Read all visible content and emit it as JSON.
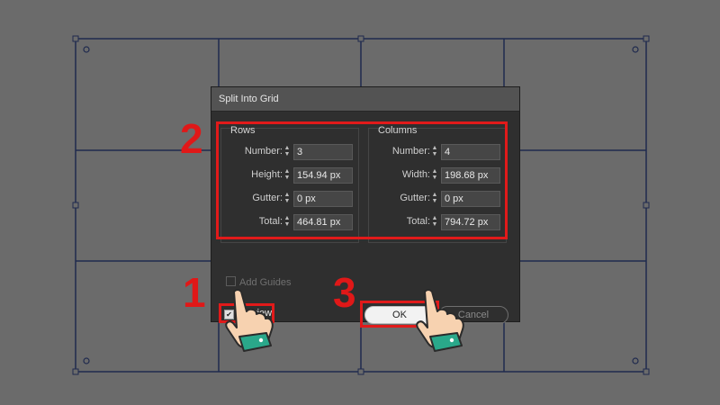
{
  "dialog": {
    "title": "Split Into Grid",
    "rows": {
      "title": "Rows",
      "fields": [
        {
          "label": "Number:",
          "value": "3"
        },
        {
          "label": "Height:",
          "value": "154.94 px"
        },
        {
          "label": "Gutter:",
          "value": "0 px"
        },
        {
          "label": "Total:",
          "value": "464.81 px"
        }
      ]
    },
    "columns": {
      "title": "Columns",
      "fields": [
        {
          "label": "Number:",
          "value": "4"
        },
        {
          "label": "Width:",
          "value": "198.68 px"
        },
        {
          "label": "Gutter:",
          "value": "0 px"
        },
        {
          "label": "Total:",
          "value": "794.72 px"
        }
      ]
    },
    "add_guides": {
      "label": "Add Guides",
      "checked": false
    },
    "preview": {
      "label": "Preview",
      "checked": true
    },
    "ok_label": "OK",
    "cancel_label": "Cancel"
  },
  "steps": {
    "one": "1",
    "two": "2",
    "three": "3"
  },
  "colors": {
    "background": "#6b6b6b",
    "grid_line": "#1f2a4e",
    "highlight": "#e11a1a",
    "dialog_bg": "#323232"
  },
  "icons": {
    "spinner": "up-down-spinner-icon",
    "hand": "pointing-hand-icon"
  }
}
